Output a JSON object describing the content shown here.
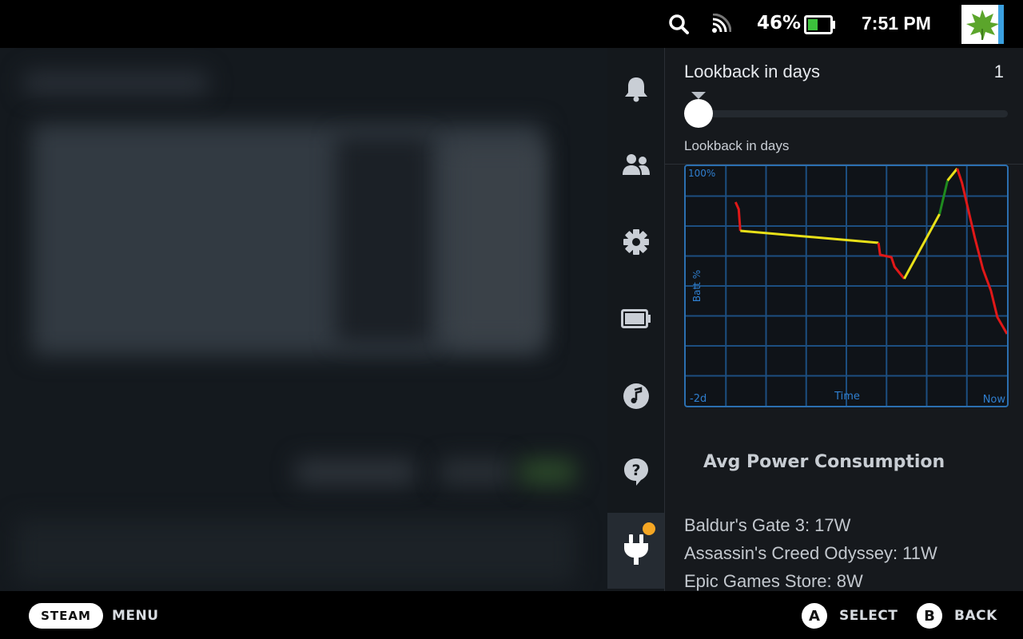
{
  "status_bar": {
    "battery_percent": "46%",
    "battery_level": 0.46,
    "time": "7:51 PM",
    "icons": [
      "search-icon",
      "wifi-icon",
      "battery-icon",
      "avatar"
    ]
  },
  "rail": {
    "items": [
      {
        "name": "notifications",
        "icon": "bell-icon"
      },
      {
        "name": "friends",
        "icon": "friends-icon"
      },
      {
        "name": "settings",
        "icon": "gear-icon"
      },
      {
        "name": "performance",
        "icon": "battery-icon"
      },
      {
        "name": "music",
        "icon": "music-icon"
      },
      {
        "name": "help",
        "icon": "help-icon"
      },
      {
        "name": "plugins",
        "icon": "plug-icon",
        "active": true,
        "badge_color": "#f5a623"
      }
    ]
  },
  "panel": {
    "lookback_title": "Lookback in days",
    "lookback_value": "1",
    "lookback_sublabel": "Lookback in days",
    "avg_power_title": "Avg Power Consumption",
    "apps": [
      "Baldur's Gate 3: 17W",
      "Assassin's Creed Odyssey: 11W",
      "Epic Games Store: 8W"
    ]
  },
  "chart_data": {
    "type": "line",
    "ylabel": "Batt %",
    "xlabel": "Time",
    "ytick_top": "100%",
    "xtick_left": "-2d",
    "xtick_right": "Now",
    "xlim": [
      -2,
      0
    ],
    "ylim": [
      0,
      100
    ],
    "grid": true,
    "colors": {
      "discharge_fast": "#e01818",
      "discharge_slow": "#e8e018",
      "charging": "#1f8a1f",
      "grid": "#1c4e80",
      "border": "#2b6fb0",
      "label": "#2f7fd0"
    },
    "segments": [
      {
        "color": "red",
        "points": [
          [
            -1.69,
            85
          ],
          [
            -1.67,
            82
          ],
          [
            -1.66,
            73
          ]
        ]
      },
      {
        "color": "yellow",
        "points": [
          [
            -1.66,
            73
          ],
          [
            -0.8,
            68
          ]
        ]
      },
      {
        "color": "red",
        "points": [
          [
            -0.8,
            68
          ],
          [
            -0.79,
            63
          ],
          [
            -0.72,
            62
          ],
          [
            -0.7,
            58
          ],
          [
            -0.64,
            53
          ]
        ]
      },
      {
        "color": "yellow",
        "points": [
          [
            -0.64,
            53
          ],
          [
            -0.42,
            80
          ]
        ]
      },
      {
        "color": "green",
        "points": [
          [
            -0.42,
            80
          ],
          [
            -0.37,
            94
          ]
        ]
      },
      {
        "color": "yellow",
        "points": [
          [
            -0.37,
            94
          ],
          [
            -0.31,
            99
          ]
        ]
      },
      {
        "color": "red",
        "points": [
          [
            -0.31,
            99
          ],
          [
            -0.28,
            93
          ],
          [
            -0.2,
            70
          ],
          [
            -0.15,
            57
          ],
          [
            -0.1,
            48
          ],
          [
            -0.06,
            37
          ],
          [
            0,
            30
          ]
        ]
      }
    ]
  },
  "bottom_bar": {
    "steam_label": "STEAM",
    "menu_label": "MENU",
    "a_glyph": "A",
    "select_label": "SELECT",
    "b_glyph": "B",
    "back_label": "BACK"
  }
}
